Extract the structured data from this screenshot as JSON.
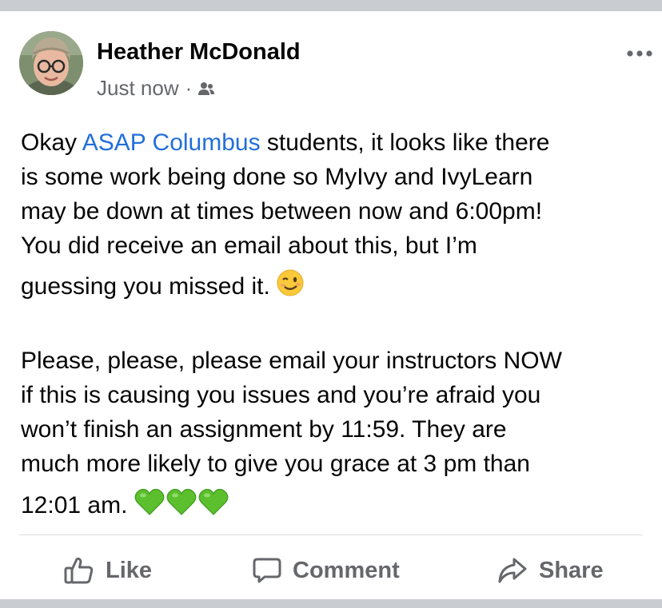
{
  "post": {
    "author": "Heather McDonald",
    "timestamp": "Just now",
    "separator": "·",
    "audience_icon": "friends-icon",
    "more_icon": "more-options-icon",
    "paragraph1": {
      "line1_before": "Okay ",
      "line1_link": "ASAP Columbus",
      "line1_after": " students, it looks like there",
      "line2": "is some work being done so MyIvy and IvyLearn",
      "line3": "may be down at times between now and 6:00pm!",
      "line4": "You did receive an email about this, but I’m",
      "line5": "guessing you missed it. ",
      "emoji": "winking-face-emoji"
    },
    "paragraph2": {
      "line1": "Please, please, please email your instructors NOW",
      "line2": "if this is causing you issues and you’re afraid you",
      "line3": "won’t finish an assignment by 11:59. They are",
      "line4": "much more likely to give you grace at 3 pm than",
      "line5": "12:01 am. ",
      "emoji": "green-heart-emoji",
      "emoji_count": 3
    },
    "link_color": "#216fdb"
  },
  "actions": {
    "like_label": "Like",
    "comment_label": "Comment",
    "share_label": "Share"
  }
}
